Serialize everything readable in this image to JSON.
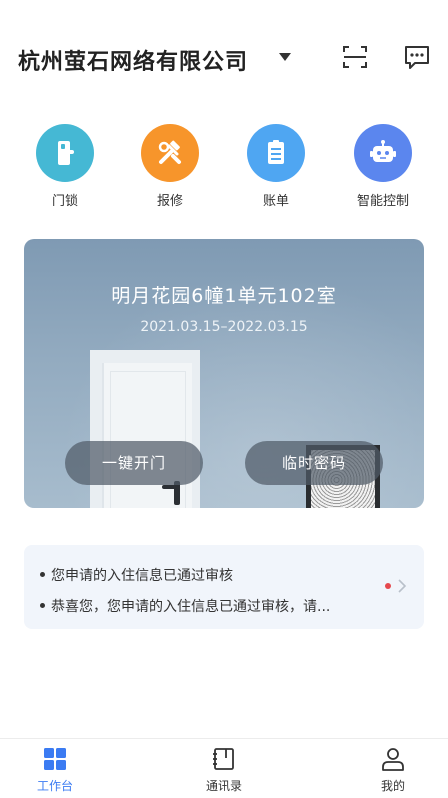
{
  "header": {
    "company": "杭州萤石网络有限公司"
  },
  "quick_actions": [
    {
      "label": "门锁",
      "icon": "door-lock-icon",
      "color": "#45b8d4"
    },
    {
      "label": "报修",
      "icon": "repair-tools-icon",
      "color": "#f7952b"
    },
    {
      "label": "账单",
      "icon": "bill-icon",
      "color": "#4fa6f2"
    },
    {
      "label": "智能控制",
      "icon": "robot-icon",
      "color": "#5b86ee"
    }
  ],
  "room": {
    "title": "明月花园6幢1单元102室",
    "dates": "2021.03.15–2022.03.15",
    "unlock_label": "一键开门",
    "temp_password_label": "临时密码"
  },
  "notices": [
    "您申请的入住信息已通过审核",
    "恭喜您，您申请的入住信息已通过审核，请..."
  ],
  "tabbar": {
    "active": "工作台",
    "tabs": [
      {
        "label": "工作台",
        "icon": "grid-icon"
      },
      {
        "label": "通讯录",
        "icon": "contacts-book-icon"
      },
      {
        "label": "我的",
        "icon": "person-icon"
      }
    ]
  },
  "colors": {
    "accent": "#3b7bf2",
    "unread": "#e5484d"
  }
}
